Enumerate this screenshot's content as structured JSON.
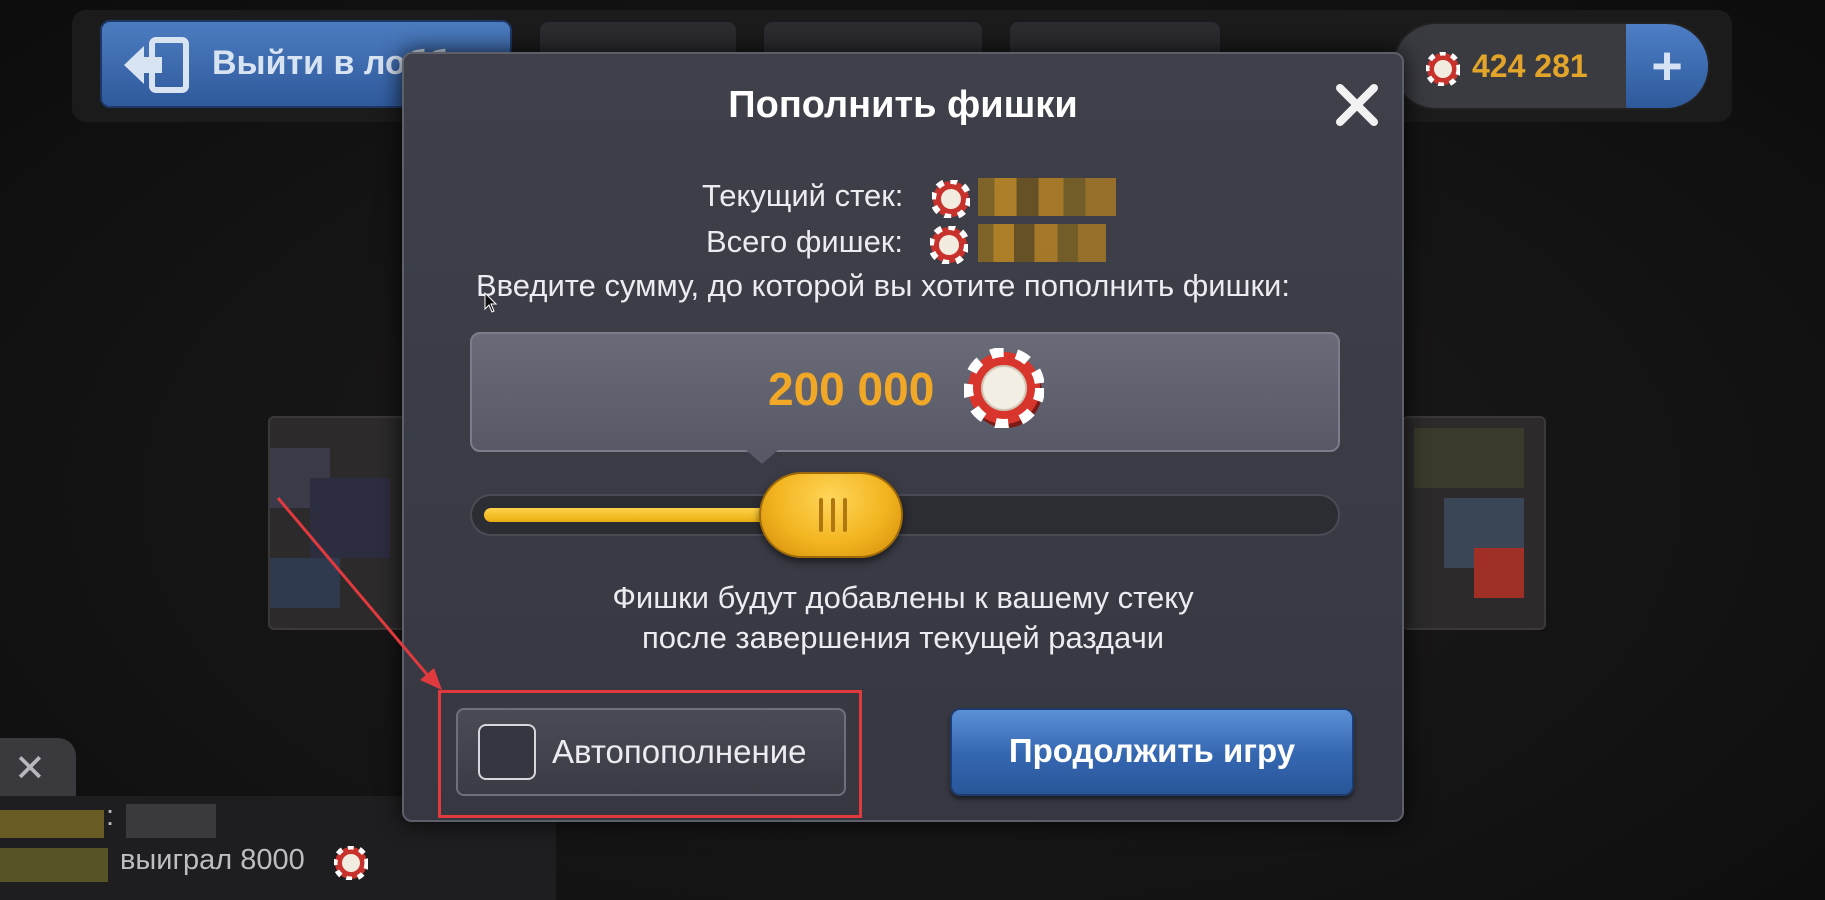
{
  "topbar": {
    "lobby_label": "Выйти в лобби",
    "tabs": [
      "",
      "",
      ""
    ],
    "balance": "424 281"
  },
  "dialog": {
    "title": "Пополнить фишки",
    "current_stack_label": "Текущий стек:",
    "total_chips_label": "Всего фишек:",
    "prompt": "Введите сумму, до которой вы хотите пополнить фишки:",
    "amount": "200 000",
    "slider_fraction": 0.37,
    "note_line1": "Фишки будут добавлены к вашему стеку",
    "note_line2": "после завершения текущей раздачи",
    "auto_refill_label": "Автопополнение",
    "auto_refill_checked": false,
    "continue_label": "Продолжить игру"
  },
  "chat": {
    "line2": "выиграл 8000",
    "colon": ":"
  },
  "colors": {
    "accent_gold": "#f0a826",
    "button_blue": "#3466b0",
    "highlight_red": "#e03a3e"
  },
  "icons": [
    "exit-door-icon",
    "chip-icon",
    "close-icon",
    "plus-icon",
    "cursor-icon"
  ]
}
